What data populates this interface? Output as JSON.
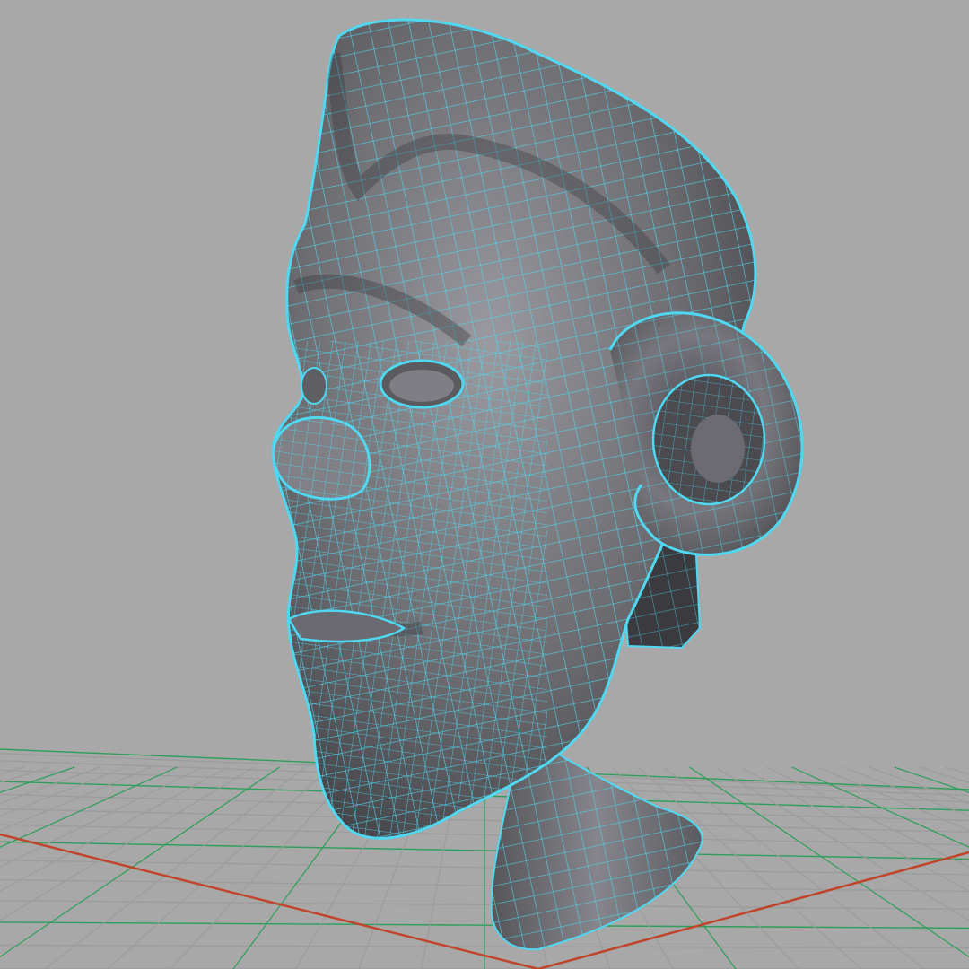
{
  "viewport": {
    "projection": "perspective",
    "shading": "smooth-shaded-with-wireframe-on-shaded",
    "selection_state": "selected"
  },
  "scene": {
    "object": {
      "kind": "polygon-head-mesh",
      "features": [
        "cranium",
        "brow",
        "eye-socket-left",
        "eye-socket-right",
        "nose",
        "lips",
        "chin",
        "ear",
        "neck",
        "jaw-block"
      ]
    },
    "ground_grid": {
      "visible": true
    }
  },
  "colors": {
    "background": "#a8a8a8",
    "mesh_surface": "#6e6e73",
    "mesh_surface_dark": "#3f3f44",
    "mesh_surface_light": "#9a9aa0",
    "wireframe": "#4fd8f0",
    "grid_lines": "#9c9c9c",
    "grid_minor": "#2e9e5a",
    "grid_axis_x": "#c0442a",
    "grid_axis_z": "#c0442a"
  },
  "icons": {
    "viewport": "3d-viewport-icon"
  }
}
